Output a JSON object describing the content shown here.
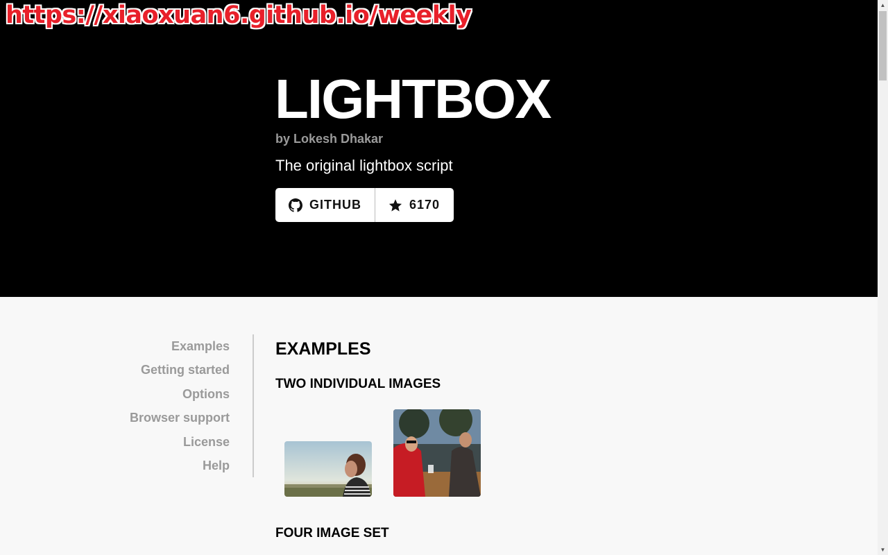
{
  "watermark": "https://xiaoxuan6.github.io/weekly",
  "hero": {
    "title": "LIGHTBOX",
    "byline": "by Lokesh Dhakar",
    "tagline": "The original lightbox script",
    "github_label": "GITHUB",
    "stars": "6170"
  },
  "nav": [
    "Examples",
    "Getting started",
    "Options",
    "Browser support",
    "License",
    "Help"
  ],
  "content": {
    "section_title": "EXAMPLES",
    "two_images_title": "TWO INDIVIDUAL IMAGES",
    "four_set_title": "FOUR IMAGE SET"
  },
  "colors": {
    "hero_bg": "#000000",
    "page_bg": "#f8f8f8",
    "nav_text": "#9a9a9a",
    "watermark": "#e8202a"
  },
  "icons": {
    "github": "github-icon",
    "star": "star-icon"
  }
}
